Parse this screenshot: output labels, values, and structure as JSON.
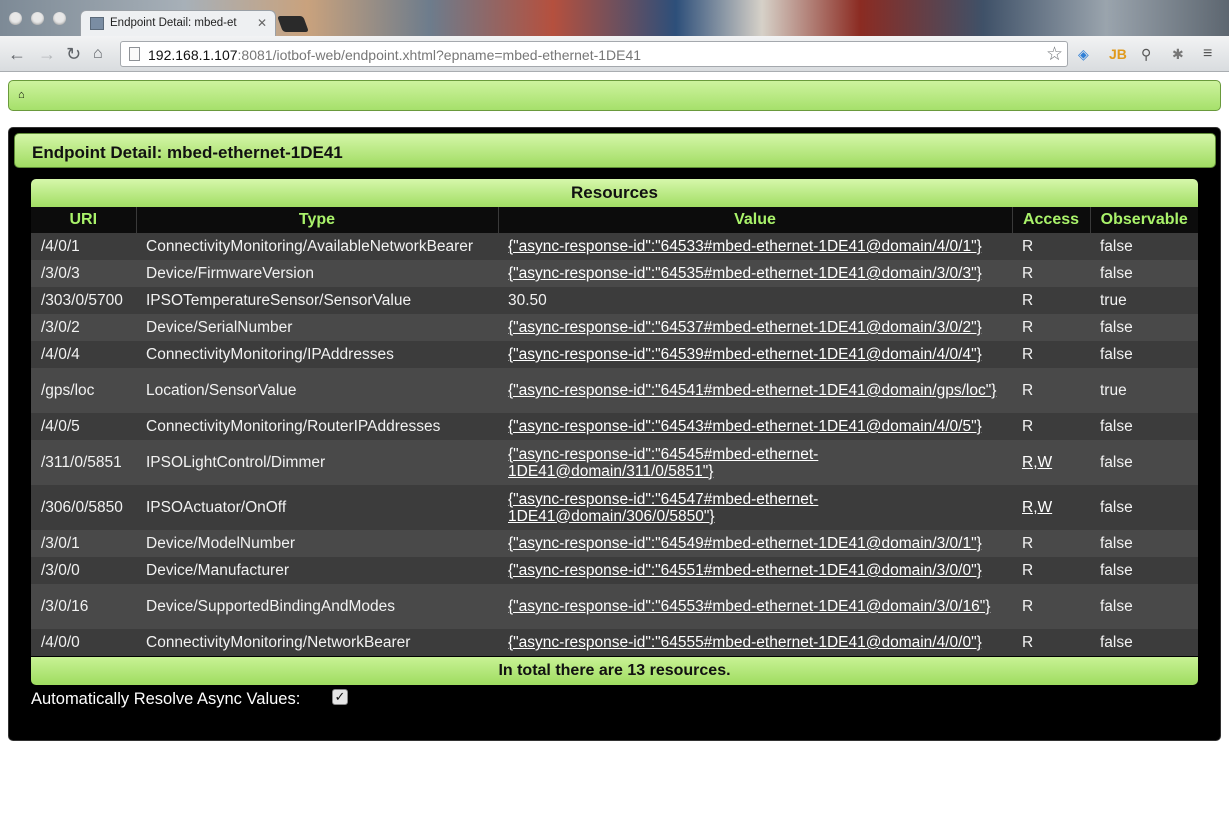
{
  "browser": {
    "tab_title": "Endpoint Detail: mbed-et",
    "url_host": "192.168.1.107",
    "url_rest": ":8081/iotbof-web/endpoint.xhtml?epname=mbed-ethernet-1DE41"
  },
  "page": {
    "title": "Endpoint Detail: mbed-ethernet-1DE41",
    "resources_caption": "Resources",
    "columns": [
      "URI",
      "Type",
      "Value",
      "Access",
      "Observable"
    ],
    "rows": [
      {
        "uri": "/4/0/1",
        "type": "ConnectivityMonitoring/AvailableNetworkBearer",
        "value": "{\"async-response-id\":\"64533#mbed-ethernet-1DE41@domain/4/0/1\"}",
        "access": "R",
        "observable": "false"
      },
      {
        "uri": "/3/0/3",
        "type": "Device/FirmwareVersion",
        "value": "{\"async-response-id\":\"64535#mbed-ethernet-1DE41@domain/3/0/3\"}",
        "access": "R",
        "observable": "false"
      },
      {
        "uri": "/303/0/5700",
        "type": "IPSOTemperatureSensor/SensorValue",
        "value": "30.50",
        "access": "R",
        "observable": "true"
      },
      {
        "uri": "/3/0/2",
        "type": "Device/SerialNumber",
        "value": "{\"async-response-id\":\"64537#mbed-ethernet-1DE41@domain/3/0/2\"}",
        "access": "R",
        "observable": "false"
      },
      {
        "uri": "/4/0/4",
        "type": "ConnectivityMonitoring/IPAddresses",
        "value": "{\"async-response-id\":\"64539#mbed-ethernet-1DE41@domain/4/0/4\"}",
        "access": "R",
        "observable": "false"
      },
      {
        "uri": "/gps/loc",
        "type": "Location/SensorValue",
        "value": "{\"async-response-id\":\"64541#mbed-ethernet-1DE41@domain/gps/loc\"}",
        "access": "R",
        "observable": "true"
      },
      {
        "uri": "/4/0/5",
        "type": "ConnectivityMonitoring/RouterIPAddresses",
        "value": "{\"async-response-id\":\"64543#mbed-ethernet-1DE41@domain/4/0/5\"}",
        "access": "R",
        "observable": "false"
      },
      {
        "uri": "/311/0/5851",
        "type": "IPSOLightControl/Dimmer",
        "value": "{\"async-response-id\":\"64545#mbed-ethernet-1DE41@domain/311/0/5851\"}",
        "access": "R,W",
        "observable": "false"
      },
      {
        "uri": "/306/0/5850",
        "type": "IPSOActuator/OnOff",
        "value": "{\"async-response-id\":\"64547#mbed-ethernet-1DE41@domain/306/0/5850\"}",
        "access": "R,W",
        "observable": "false"
      },
      {
        "uri": "/3/0/1",
        "type": "Device/ModelNumber",
        "value": "{\"async-response-id\":\"64549#mbed-ethernet-1DE41@domain/3/0/1\"}",
        "access": "R",
        "observable": "false"
      },
      {
        "uri": "/3/0/0",
        "type": "Device/Manufacturer",
        "value": "{\"async-response-id\":\"64551#mbed-ethernet-1DE41@domain/3/0/0\"}",
        "access": "R",
        "observable": "false"
      },
      {
        "uri": "/3/0/16",
        "type": "Device/SupportedBindingAndModes",
        "value": "{\"async-response-id\":\"64553#mbed-ethernet-1DE41@domain/3/0/16\"}",
        "access": "R",
        "observable": "false"
      },
      {
        "uri": "/4/0/0",
        "type": "ConnectivityMonitoring/NetworkBearer",
        "value": "{\"async-response-id\":\"64555#mbed-ethernet-1DE41@domain/4/0/0\"}",
        "access": "R",
        "observable": "false"
      }
    ],
    "footer": "In total there are 13 resources.",
    "auto_resolve_label": "Automatically Resolve Async Values:",
    "auto_resolve_checked": true
  }
}
